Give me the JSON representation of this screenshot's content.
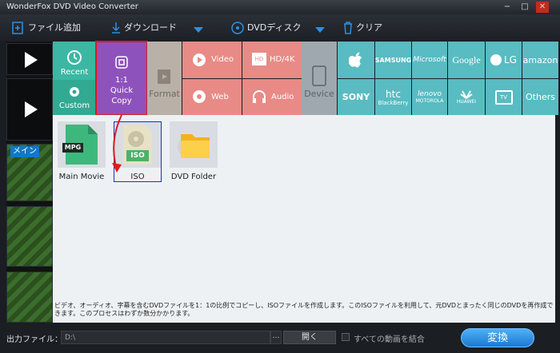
{
  "window": {
    "title": "WonderFox DVD Video Converter",
    "min": "−",
    "max": "□",
    "close": "✕"
  },
  "toolbar": {
    "add_file": "ファイル追加",
    "download": "ダウンロード",
    "dvd_disc": "DVDディスク",
    "clear": "クリア"
  },
  "left_thumbs": {
    "main_label": "メイン"
  },
  "menu": {
    "recent": "Recent",
    "custom": "Custom",
    "quick_copy_line1": "1:1",
    "quick_copy_line2": "Quick",
    "quick_copy_line3": "Copy",
    "format": "Format",
    "video": "Video",
    "hd4k": "HD/4K",
    "web": "Web",
    "audio": "Audio",
    "device": "Device",
    "hd_badge": "HD",
    "brands": [
      "SAMSUNG",
      "Microsoft",
      "Google",
      "LG",
      "amazon",
      "SONY",
      "htc",
      "lenovo",
      "HUAWEI",
      "TV",
      "Others"
    ],
    "brands_sub": {
      "htc": "BlackBerry",
      "lenovo": "MOTOROLA"
    }
  },
  "tiles": {
    "mpg_badge": "MPG",
    "iso_badge": "ISO",
    "main_movie": "Main Movie",
    "iso": "ISO",
    "dvd_folder": "DVD Folder"
  },
  "description": "ビデオ、オーディオ、字幕を含むDVDファイルを1：1の比例でコピーし、ISOファイルを作成します。このISOファイルを利用して、元DVDとまったく同じのDVDを再作成できます。このプロセスはわずか数分かかります。",
  "bottom": {
    "output_label": "出力ファイル：",
    "output_path": "D:\\",
    "browse": "…",
    "open": "開く",
    "merge_label": "すべての動画を結合",
    "convert": "変換"
  },
  "colors": {
    "accent_blue": "#1c78d2",
    "quick_copy_purple": "#8e52bd",
    "teal": "#3bb7a3",
    "brand_teal": "#58bcc2",
    "salmon": "#e88a86",
    "highlight_red": "#e11919"
  }
}
